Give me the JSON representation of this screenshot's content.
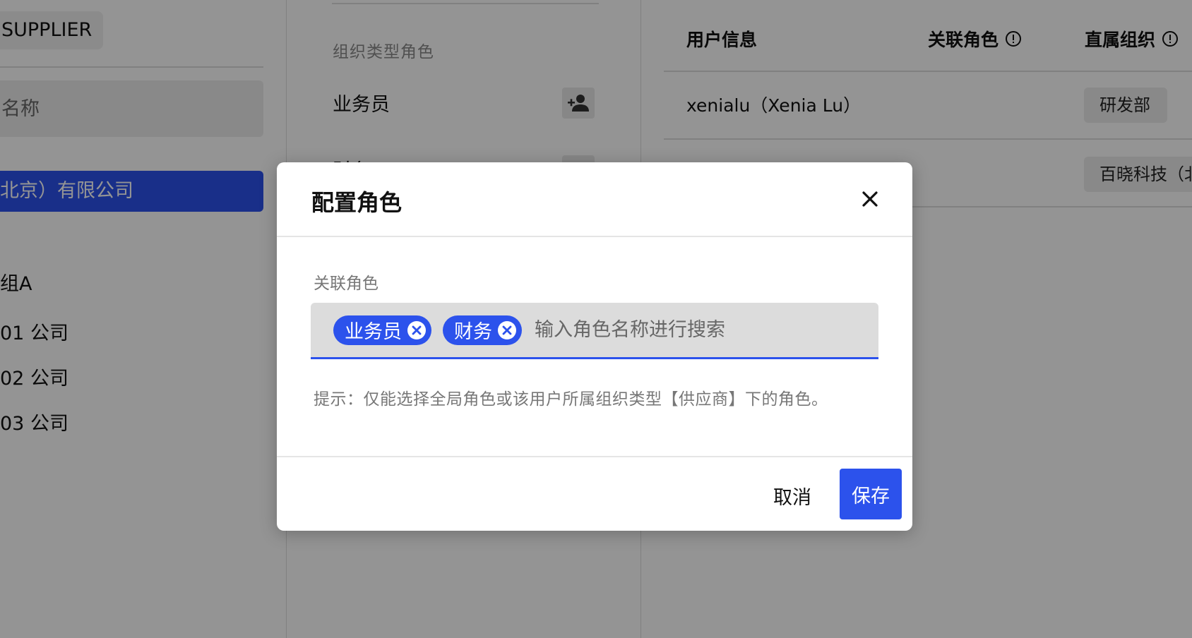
{
  "left": {
    "org_tag": "SUPPLIER",
    "search_placeholder": "名称",
    "selected_company": "北京）有限公司",
    "group_label": "组A",
    "sub_items": [
      "01 公司",
      "02 公司",
      "03 公司"
    ]
  },
  "middle": {
    "section_title": "组织类型角色",
    "roles": [
      "业务员",
      "财务"
    ]
  },
  "right": {
    "columns": {
      "user_info": "用户信息",
      "linked_roles": "关联角色",
      "direct_org": "直属组织"
    },
    "rows": [
      {
        "user": "xenialu（Xenia Lu）",
        "org": "研发部"
      },
      {
        "user": "",
        "org": "百晓科技（北"
      }
    ]
  },
  "modal": {
    "title": "配置角色",
    "field_label": "关联角色",
    "selected_roles": [
      "业务员",
      "财务"
    ],
    "search_placeholder": "输入角色名称进行搜索",
    "hint": "提示：仅能选择全局角色或该用户所属组织类型【供应商】下的角色。",
    "cancel_label": "取消",
    "save_label": "保存"
  },
  "colors": {
    "accent": "#2c52ec",
    "overlay": "rgba(0,0,0,0.42)"
  },
  "icons": [
    "add-user-icon",
    "info-icon",
    "close-icon",
    "chip-remove-icon"
  ]
}
